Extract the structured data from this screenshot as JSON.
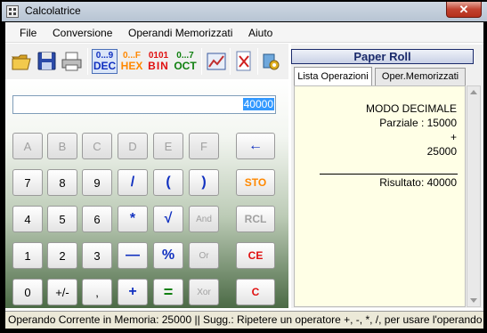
{
  "window": {
    "title": "Calcolatrice",
    "close_glyph": "✕"
  },
  "menu": [
    "File",
    "Conversione",
    "Operandi Memorizzati",
    "Aiuto"
  ],
  "toolbar": {
    "dec": {
      "top": "0...9",
      "bottom": "DEC"
    },
    "hex": {
      "top": "0...F",
      "bottom": "HEX"
    },
    "bin": {
      "top": "0101",
      "bottom": "BIN"
    },
    "oct": {
      "top": "0...7",
      "bottom": "OCT"
    },
    "icons": [
      "open-folder-icon",
      "save-disk-icon",
      "printer-icon",
      "chart-icon",
      "clear-sheet-icon",
      "settings-icon"
    ]
  },
  "display": {
    "value": "40000"
  },
  "keys": {
    "A": "A",
    "B": "B",
    "C": "C",
    "D": "D",
    "E": "E",
    "F": "F",
    "n7": "7",
    "n8": "8",
    "n9": "9",
    "n4": "4",
    "n5": "5",
    "n6": "6",
    "n1": "1",
    "n2": "2",
    "n3": "3",
    "n0": "0",
    "div": "/",
    "lpar": "(",
    "rpar": ")",
    "mul": "*",
    "sqrt": "√",
    "and": "And",
    "minus": "—",
    "perc": "%",
    "or": "Or",
    "plus": "+",
    "eq": "=",
    "xor": "Xor",
    "sign": "+/-",
    "comma": ",",
    "sto": "STO",
    "rcl": "RCL",
    "ce": "CE",
    "c": "C",
    "back": "←"
  },
  "paper": {
    "header": "Paper Roll",
    "tabs": [
      "Lista Operazioni",
      "Oper.Memorizzati"
    ],
    "lines": [
      "MODO DECIMALE",
      "Parziale : 15000",
      "+",
      "25000",
      "Risultato: 40000"
    ]
  },
  "status": "Operando Corrente in Memoria: 25000 || Sugg.: Ripetere un operatore +, -, *, /, per usare l'operando in memoria",
  "colors": {
    "accent_blue": "#1030c0",
    "green": "#108010",
    "orange": "#ff8800",
    "red": "#e01010",
    "paper": "#ffffe6"
  }
}
